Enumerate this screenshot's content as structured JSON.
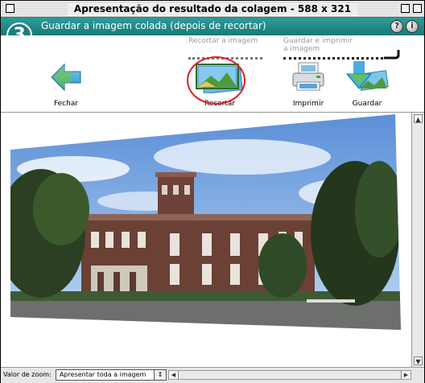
{
  "window": {
    "title": "Apresentação do resultado da colagem - 588 x 321"
  },
  "header": {
    "step_number": "3",
    "title": "Guardar a imagem colada (depois de recortar)",
    "help_symbol": "?",
    "info_symbol": "i"
  },
  "toolbar": {
    "hint_crop": "Recortar a imagem",
    "hint_save_print_line1": "Guardar e imprimir",
    "hint_save_print_line2": "a imagem",
    "buttons": [
      {
        "label": "Fechar",
        "icon": "back-arrow-icon"
      },
      {
        "label": "Recortar",
        "icon": "crop-icon"
      },
      {
        "label": "Imprimir",
        "icon": "printer-icon"
      },
      {
        "label": "Guardar",
        "icon": "save-icon"
      }
    ],
    "highlight_color": "#e31b1b"
  },
  "status": {
    "zoom_label": "Valor de zoom:",
    "zoom_value": "Apresentar toda a imagem"
  },
  "colors": {
    "header_teal": "#1f8886",
    "accent_red": "#e31b1b"
  }
}
